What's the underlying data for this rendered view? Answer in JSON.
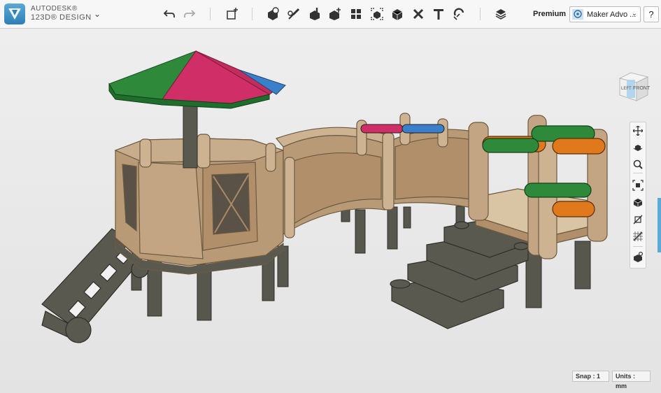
{
  "app": {
    "brand_line1": "AUTODESK®",
    "brand_line2": "123D® DESIGN"
  },
  "toolbar": {
    "undo": "undo-icon",
    "redo": "redo-icon",
    "icons": [
      "primitives-icon",
      "sketch-icon",
      "construct-icon",
      "modify-icon",
      "pattern-icon",
      "group-icon",
      "combine-icon",
      "measure-icon",
      "text-icon",
      "snap-icon",
      "material-icon"
    ]
  },
  "header": {
    "premium_label": "Premium",
    "user_name": "Maker Advo ...",
    "help_label": "?"
  },
  "viewcube": {
    "left_label": "LEFT",
    "front_label": "FRONT"
  },
  "status": {
    "snap_label": "Snap : 1",
    "units_label": "Units : mm"
  },
  "colors": {
    "accent": "#5aa9d6",
    "wood": "#b99a76",
    "dark_plastic": "#58574e",
    "green": "#2e8a3a",
    "magenta": "#cf2f66",
    "blue": "#3a7fc9",
    "orange": "#e0791c"
  }
}
